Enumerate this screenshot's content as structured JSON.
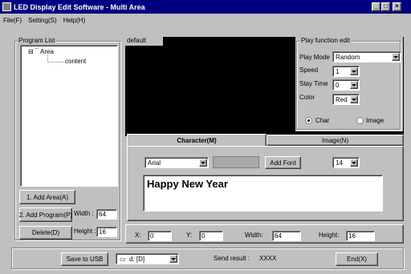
{
  "window": {
    "title": "LED Display Edit Software - Multi Area",
    "minimize": "_",
    "maximize": "□",
    "close": "×"
  },
  "menu": [
    "File(F)",
    "Setting(S)",
    "Help(H)"
  ],
  "program_list": {
    "title": "Program List",
    "tree": {
      "root": "Area",
      "root_toggle": "⊟",
      "child": "content"
    }
  },
  "buttons": {
    "add_area": "1.  Add Area(A)",
    "add_program": "2. Add Program(P)",
    "delete": "Delete(D)",
    "add_font": "Add Font",
    "save_usb": "Save to USB",
    "end": "End(X)"
  },
  "size": {
    "width_label": "Width :",
    "width_value": "64",
    "height_label": "Height :",
    "height_value": "16"
  },
  "preview": {
    "area_label": "default"
  },
  "play_edit": {
    "title": "Play function edit",
    "mode_label": "Play Mode",
    "mode_value": "Random",
    "speed_label": "Speed",
    "speed_value": "1",
    "stay_label": "Stay Time",
    "stay_value": "0",
    "color_label": "Color",
    "color_value": "Red",
    "radio_char": "Char",
    "radio_image": "Image",
    "selected": "char"
  },
  "tabs": {
    "character": "Character(M)",
    "image": "Image(N)"
  },
  "character": {
    "font": "Arial",
    "font_size": "14",
    "text": "Happy New Year"
  },
  "geometry": {
    "x_label": "X:",
    "x_value": "0",
    "y_label": "Y:",
    "y_value": "0",
    "w_label": "Width:",
    "w_value": "64",
    "h_label": "Height:",
    "h_value": "16"
  },
  "footer": {
    "drive": "d: [D]",
    "send_label": "Send result :",
    "send_value": "XXXX"
  }
}
